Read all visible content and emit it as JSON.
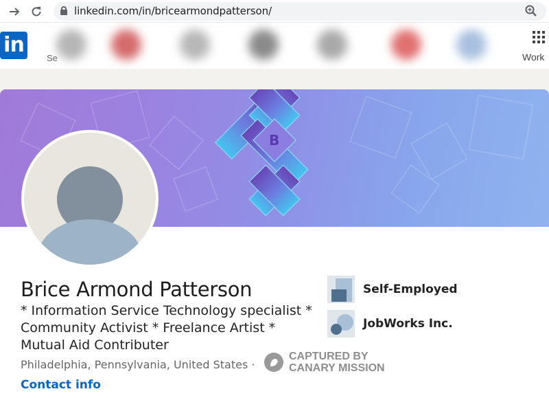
{
  "browser": {
    "url": "linkedin.com/in/bricearmondpatterson/"
  },
  "header": {
    "logo_text": "in",
    "search_fragment": "Se",
    "work_label": "Work",
    "colors": {
      "brand": "#0a66c2"
    }
  },
  "banner": {
    "emblem_letter": "B"
  },
  "profile": {
    "name": "Brice Armond Patterson",
    "headline": "* Information Service Technology specialist * Community Activist * Freelance Artist * Mutual Aid Contributer",
    "location": "Philadelphia, Pennsylvania, United States ·",
    "contact_info": "Contact info"
  },
  "experience": [
    {
      "label": "Self-Employed",
      "icon": "company-logo-placeholder-icon"
    },
    {
      "label": "JobWorks Inc.",
      "icon": "school-logo-placeholder-icon"
    }
  ],
  "watermark": {
    "line1": "CAPTURED BY",
    "line2": "CANARY MISSION",
    "icon": "canary-bird-icon"
  }
}
